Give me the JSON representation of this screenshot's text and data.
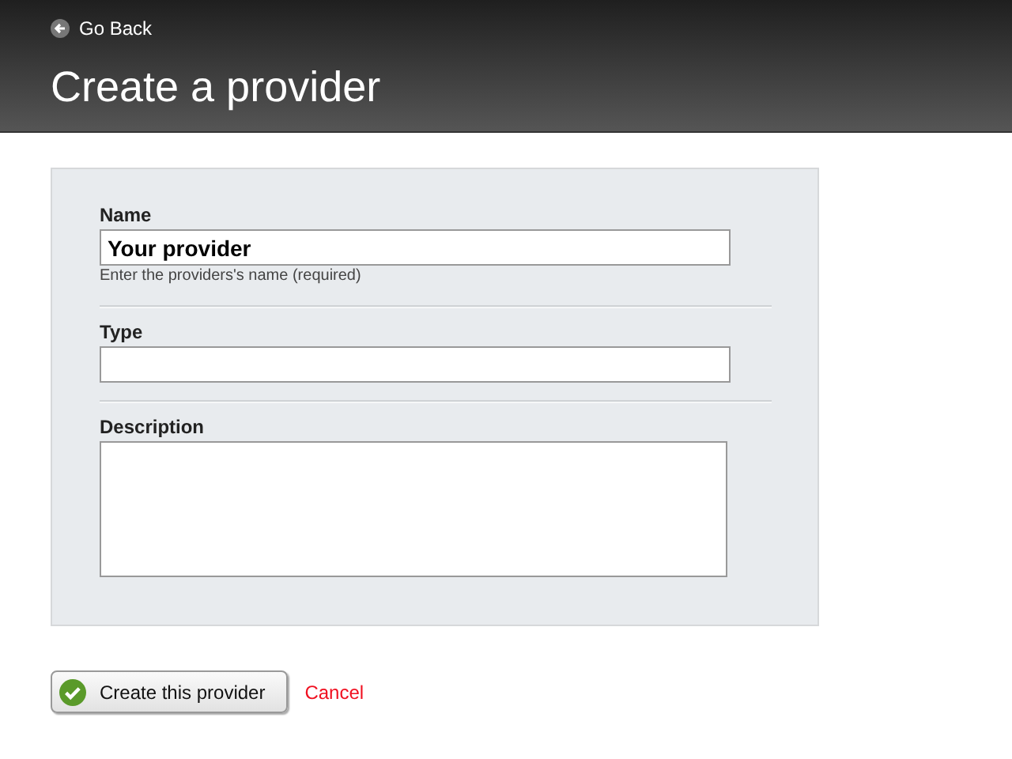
{
  "header": {
    "back_link": "Go Back",
    "title": "Create a provider"
  },
  "form": {
    "fields": [
      {
        "kind": "text",
        "label": "Name",
        "value": "Your provider",
        "hint": "Enter the providers's name (required)"
      },
      {
        "kind": "text",
        "label": "Type"
      },
      {
        "kind": "textarea",
        "label": "Description"
      }
    ]
  },
  "actions": {
    "submit": "Create this provider",
    "cancel": "Cancel"
  }
}
